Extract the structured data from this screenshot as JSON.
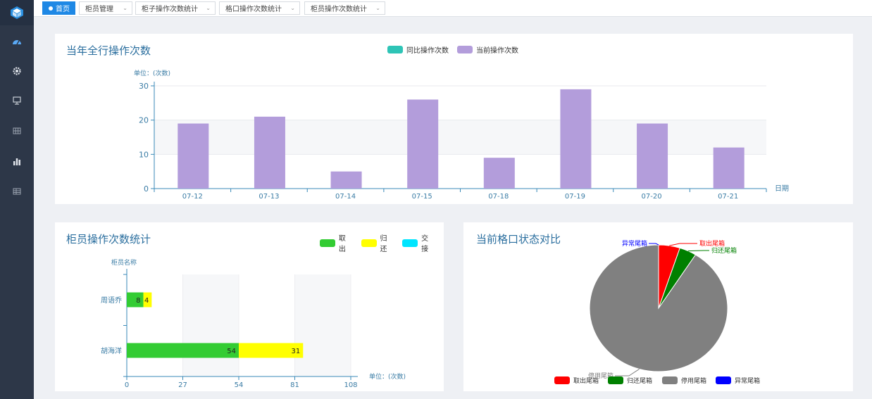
{
  "tabs": [
    {
      "label": "首页"
    },
    {
      "label": "柜员管理"
    },
    {
      "label": "柜子操作次数统计"
    },
    {
      "label": "格口操作次数统计"
    },
    {
      "label": "柜员操作次数统计"
    }
  ],
  "sidebar": {
    "items": [
      {
        "icon": "dashboard-icon"
      },
      {
        "icon": "gear-icon"
      },
      {
        "icon": "monitor-icon"
      },
      {
        "icon": "grid-icon"
      },
      {
        "icon": "bar-chart-icon"
      },
      {
        "icon": "table-icon"
      }
    ]
  },
  "colors": {
    "accent": "#1e88e5",
    "sidebar": "#2d3748",
    "title": "#2a6e9e",
    "bar_current": "#b39ddb",
    "bar_yoy": "#2ec4b6",
    "takeout": "#33cc33",
    "return": "#ffff00",
    "handover": "#00e5ff",
    "pie_takeout": "#ff0000",
    "pie_return": "#008000",
    "pie_disabled": "#808080",
    "pie_abnormal": "#0000ff"
  },
  "chart_data": [
    {
      "type": "bar",
      "title": "当年全行操作次数",
      "legend": [
        "同比操作次数",
        "当前操作次数"
      ],
      "ylabel": "单位：(次数)",
      "xlabel": "日期",
      "categories": [
        "07-12",
        "07-13",
        "07-14",
        "07-15",
        "07-18",
        "07-19",
        "07-20",
        "07-21"
      ],
      "series": [
        {
          "name": "同比操作次数",
          "values": [
            0,
            0,
            0,
            0,
            0,
            0,
            0,
            0
          ]
        },
        {
          "name": "当前操作次数",
          "values": [
            19,
            21,
            5,
            26,
            9,
            29,
            19,
            12
          ]
        }
      ],
      "ylim": [
        0,
        30
      ],
      "yticks": [
        0,
        10,
        20,
        30
      ]
    },
    {
      "type": "bar",
      "orientation": "horizontal",
      "stacked": true,
      "title": "柜员操作次数统计",
      "legend": [
        "取出",
        "归还",
        "交接"
      ],
      "ylabel": "柜员名称",
      "xlabel": "单位：(次数)",
      "categories": [
        "胡海洋",
        "周语乔"
      ],
      "series": [
        {
          "name": "取出",
          "values": [
            54,
            8
          ]
        },
        {
          "name": "归还",
          "values": [
            31,
            4
          ]
        },
        {
          "name": "交接",
          "values": [
            0,
            0
          ]
        }
      ],
      "xlim": [
        0,
        108
      ],
      "xticks": [
        0,
        27,
        54,
        81,
        108
      ]
    },
    {
      "type": "pie",
      "title": "当前格口状态对比",
      "legend": [
        "取出尾箱",
        "归还尾箱",
        "停用尾箱",
        "异常尾箱"
      ],
      "slices": [
        {
          "name": "取出尾箱",
          "value": 5
        },
        {
          "name": "归还尾箱",
          "value": 4
        },
        {
          "name": "停用尾箱",
          "value": 91
        },
        {
          "name": "异常尾箱",
          "value": 0
        }
      ]
    }
  ]
}
